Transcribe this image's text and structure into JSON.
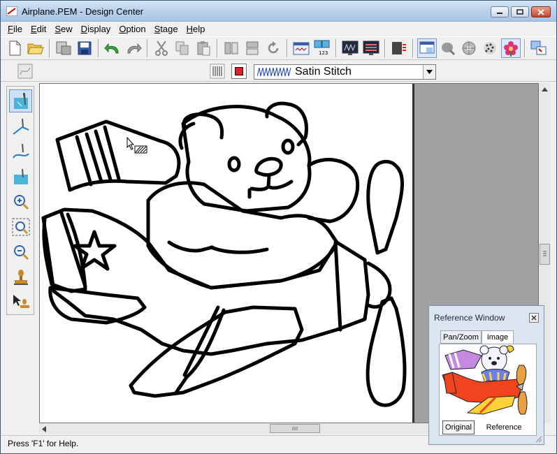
{
  "window": {
    "title": "Airplane.PEM - Design Center"
  },
  "menu": [
    {
      "label": "File",
      "underline": "F",
      "rest": "ile"
    },
    {
      "label": "Edit",
      "underline": "E",
      "rest": "dit"
    },
    {
      "label": "Sew",
      "underline": "S",
      "rest": "ew"
    },
    {
      "label": "Display",
      "underline": "D",
      "rest": "isplay"
    },
    {
      "label": "Option",
      "underline": "O",
      "rest": "ption"
    },
    {
      "label": "Stage",
      "underline": "S",
      "rest": "tage"
    },
    {
      "label": "Help",
      "underline": "H",
      "rest": "elp"
    }
  ],
  "stitch": {
    "selected": "Satin Stitch",
    "thread_color": "#e02020"
  },
  "status": {
    "help_text": "Press 'F1' for Help."
  },
  "reference_window": {
    "title": "Reference Window",
    "tabs": [
      "Pan/Zoom",
      "Image"
    ],
    "active_tab": "Image",
    "buttons": [
      "Original",
      "Reference"
    ],
    "active_button": "Original"
  },
  "colors": {
    "accent": "#3a6ea5",
    "canvas_bg": "#a0a0a0"
  }
}
